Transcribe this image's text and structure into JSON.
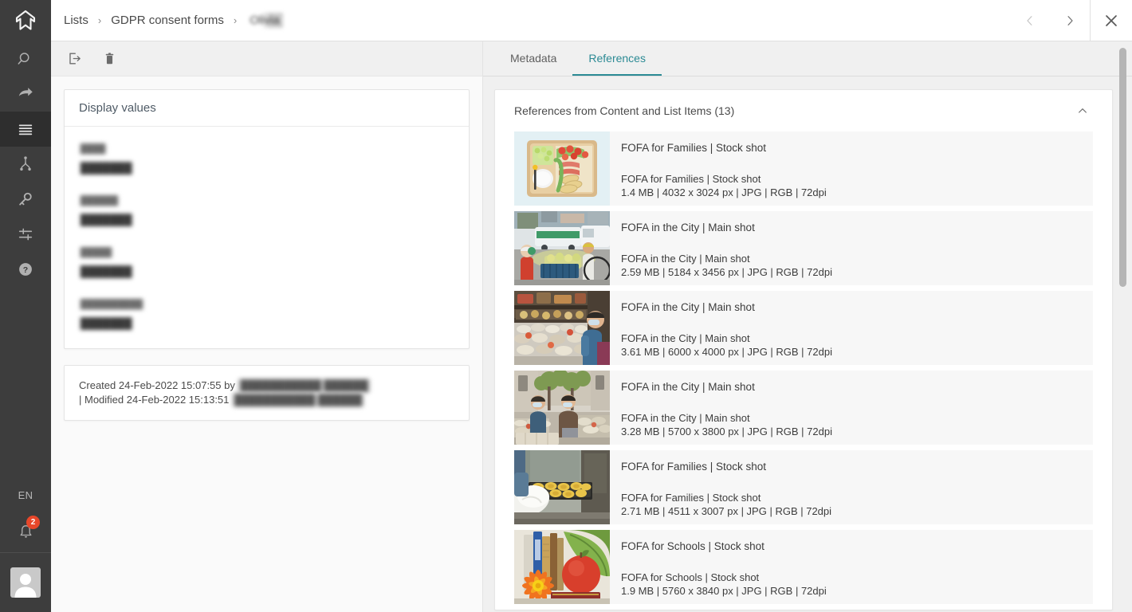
{
  "app": {
    "logo_icon": "cloudinary-chevron-logo"
  },
  "sidebar": {
    "items": [
      {
        "name": "search",
        "icon": "search-icon",
        "label": "Search",
        "active": false
      },
      {
        "name": "share",
        "icon": "share-arrow-icon",
        "label": "Share",
        "active": false
      },
      {
        "name": "lists",
        "icon": "list-lines-icon",
        "label": "Lists",
        "active": true
      },
      {
        "name": "taxonomy",
        "icon": "taxonomy-tree-icon",
        "label": "Taxonomy",
        "active": false
      },
      {
        "name": "permissions",
        "icon": "key-icon",
        "label": "Permissions",
        "active": false
      },
      {
        "name": "settings",
        "icon": "sliders-icon",
        "label": "Settings",
        "active": false
      },
      {
        "name": "help",
        "icon": "question-circle-icon",
        "label": "Help",
        "active": false
      }
    ],
    "language": "EN",
    "notifications": {
      "icon": "bell-icon",
      "count": "2",
      "badge_color": "#e8472a"
    },
    "avatar": {
      "icon": "user-avatar-icon",
      "label": "Account"
    }
  },
  "header": {
    "breadcrumb": [
      {
        "label": "Lists",
        "redacted": false
      },
      {
        "label": "GDPR consent forms",
        "redacted": false
      },
      {
        "label": "Olivia",
        "redacted": true
      }
    ],
    "separator": "›",
    "prev_label": "‹",
    "next_label": "›",
    "close_label": "✕"
  },
  "left_pane": {
    "toolbar": [
      {
        "name": "export-item",
        "icon": "export-out-icon",
        "label": "Export"
      },
      {
        "name": "delete-item",
        "icon": "trash-icon",
        "label": "Delete"
      }
    ],
    "display_values": {
      "title": "Display values",
      "fields": [
        {
          "label": "████",
          "value": "███████"
        },
        {
          "label": "██████",
          "value": "███████"
        },
        {
          "label": "█████",
          "value": "███████"
        },
        {
          "label": "██████████",
          "value": "███████"
        }
      ]
    },
    "audit": {
      "created_text": "Created 24-Feb-2022 15:07:55 by",
      "created_user": "███████████ ██████",
      "modified_text": "| Modified 24-Feb-2022 15:13:51",
      "modified_user": "███████████ ██████"
    }
  },
  "right_pane": {
    "tabs": [
      {
        "label": "Metadata",
        "active": false
      },
      {
        "label": "References",
        "active": true
      }
    ],
    "active_accent": "#2b8a94",
    "references_panel": {
      "title": "References from Content and List Items (13)",
      "collapse_icon": "chevron-up-icon",
      "rows": [
        {
          "title": "FOFA for Families | Stock shot",
          "subtitle": "FOFA for Families | Stock shot",
          "meta": "1.4 MB | 4032 x 3024 px | JPG | RGB | 72dpi",
          "thumb": "bento-box-food-tray"
        },
        {
          "title": "FOFA in the City | Main shot",
          "subtitle": "FOFA in the City | Main shot",
          "meta": "2.59 MB | 5184 x 3456 px | JPG | RGB | 72dpi",
          "thumb": "street-market-bus"
        },
        {
          "title": "FOFA in the City | Main shot",
          "subtitle": "FOFA in the City | Main shot",
          "meta": "3.61 MB | 6000 x 4000 px | JPG | RGB | 72dpi",
          "thumb": "market-stall-shopper"
        },
        {
          "title": "FOFA in the City | Main shot",
          "subtitle": "FOFA in the City | Main shot",
          "meta": "3.28 MB | 5700 x 3800 px | JPG | RGB | 72dpi",
          "thumb": "outdoor-market-street"
        },
        {
          "title": "FOFA for Families | Stock shot",
          "subtitle": "FOFA for Families | Stock shot",
          "meta": "2.71 MB | 4511 x 3007 px | JPG | RGB | 72dpi",
          "thumb": "baker-pastry-tray"
        },
        {
          "title": "FOFA for Schools | Stock shot",
          "subtitle": "FOFA for Schools | Stock shot",
          "meta": "1.9 MB | 5760 x 3840 px | JPG | RGB | 72dpi",
          "thumb": "books-apple-flower"
        }
      ]
    }
  }
}
